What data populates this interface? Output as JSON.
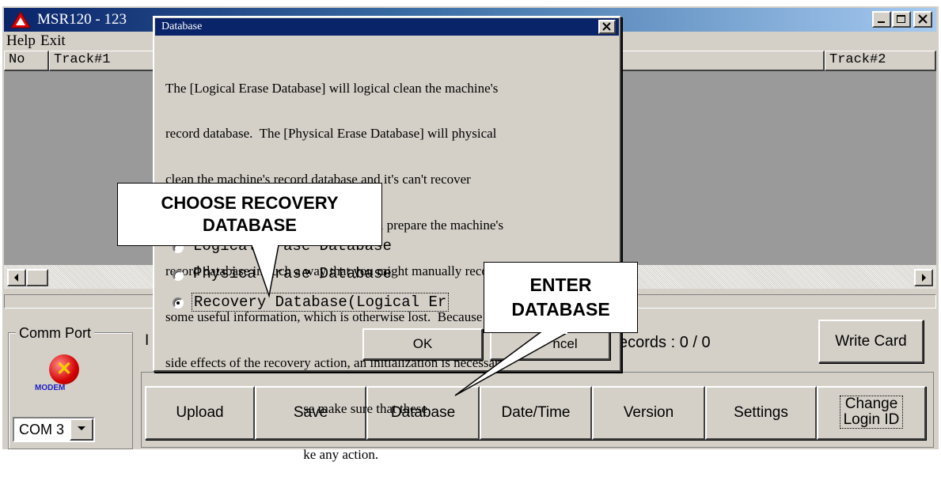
{
  "app": {
    "title": "MSR120 - 123",
    "menu": [
      "Help",
      "Exit"
    ],
    "window_controls": [
      "minimize",
      "maximize",
      "close"
    ]
  },
  "list": {
    "columns": [
      "No",
      "Track#1",
      "Track#2"
    ]
  },
  "bottom": {
    "comm_port_label": "Comm Port",
    "modem_text": "MODEM",
    "com_port_value": "COM 3",
    "ip_partial": "I",
    "records_text": "ecords : 0 / 0",
    "write_card": "Write Card",
    "toolbar": [
      "Upload",
      "Save",
      "Database",
      "Date/Time",
      "Version",
      "Settings"
    ],
    "change_login_line1": "Change",
    "change_login_line2": "Login ID"
  },
  "dialog": {
    "title": "Database",
    "close_glyph": "×",
    "message_lines": [
      "The [Logical Erase Database] will logical clean the machine's",
      "record database.  The [Physical Erase Database] will physical",
      "clean the machine's record database and it's can't recover",
      "database.  The [Recovery Database] will prepare the machine's",
      "record database in such a way that you might manually recover",
      "some useful information, which is otherwise lost.  Because of the",
      "side effects of the recovery action, an initialization is necessary",
      "                                         se make sure that these",
      "                                         ke any action."
    ],
    "options": [
      {
        "label": "Logical Erase Database",
        "selected": false
      },
      {
        "label": "Physica  Erase Database",
        "selected": false
      },
      {
        "label": "Recovery Database(Logical Er",
        "selected": true
      }
    ],
    "ok": "OK",
    "cancel": "ncel"
  },
  "callouts": {
    "choose_line1": "CHOOSE  RECOVERY",
    "choose_line2": "DATABASE",
    "enter_line1": "ENTER",
    "enter_line2": "DATABASE"
  },
  "colors": {
    "face": "#d4d0c8",
    "title_active": "#0a246a",
    "list_bg": "#9a9a9a",
    "icon_red": "#d40000"
  }
}
